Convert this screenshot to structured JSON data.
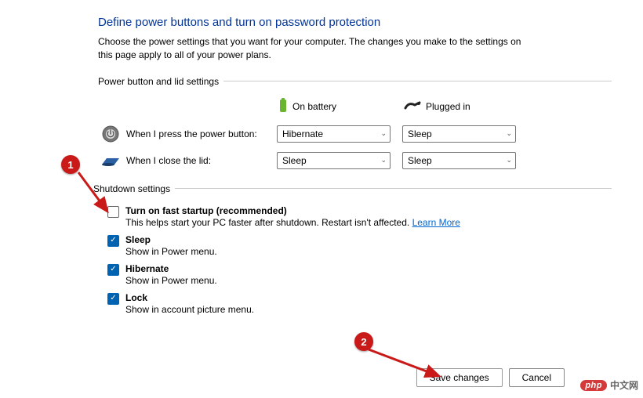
{
  "title": "Define power buttons and turn on password protection",
  "subtitle": "Choose the power settings that you want for your computer. The changes you make to the settings on this page apply to all of your power plans.",
  "section1": {
    "header": "Power button and lid settings",
    "col_battery": "On battery",
    "col_plugged": "Plugged in",
    "rows": [
      {
        "label": "When I press the power button:",
        "battery": "Hibernate",
        "plugged": "Sleep"
      },
      {
        "label": "When I close the lid:",
        "battery": "Sleep",
        "plugged": "Sleep"
      }
    ]
  },
  "section2": {
    "header": "Shutdown settings",
    "items": [
      {
        "checked": false,
        "title": "Turn on fast startup (recommended)",
        "desc": "This helps start your PC faster after shutdown. Restart isn't affected. ",
        "link": "Learn More"
      },
      {
        "checked": true,
        "title": "Sleep",
        "desc": "Show in Power menu."
      },
      {
        "checked": true,
        "title": "Hibernate",
        "desc": "Show in Power menu."
      },
      {
        "checked": true,
        "title": "Lock",
        "desc": "Show in account picture menu."
      }
    ]
  },
  "buttons": {
    "save": "Save changes",
    "cancel": "Cancel"
  },
  "callouts": {
    "one": "1",
    "two": "2"
  },
  "watermark": {
    "pill": "php",
    "txt": "中文网"
  }
}
